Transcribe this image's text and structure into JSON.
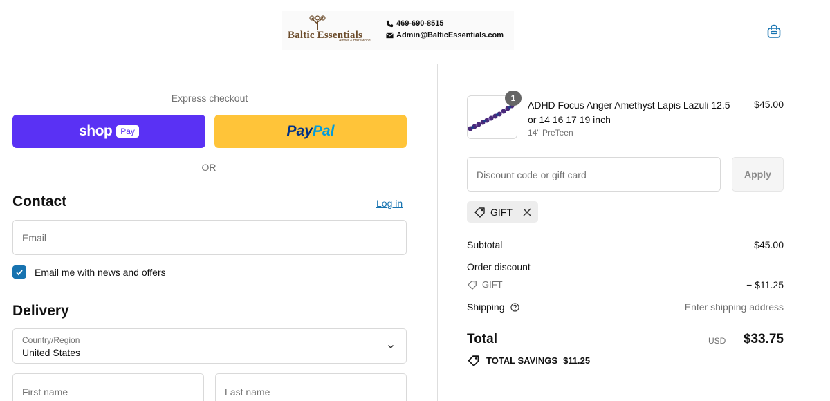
{
  "header": {
    "logo_text": "Baltic Essentials",
    "logo_tagline": "Amber & Hazelwood",
    "phone": "469-690-8515",
    "email": "Admin@BalticEssentials.com",
    "cart_icon": "shopping-bag-icon"
  },
  "express": {
    "label": "Express checkout",
    "shop_word": "shop",
    "shop_pay_pill": "Pay",
    "paypal_part1": "Pay",
    "paypal_part2": "Pal",
    "or_text": "OR"
  },
  "contact": {
    "title": "Contact",
    "login_link": "Log in",
    "email_placeholder": "Email",
    "newsletter_label": "Email me with news and offers",
    "newsletter_checked": true
  },
  "delivery": {
    "title": "Delivery",
    "country_label": "Country/Region",
    "country_value": "United States",
    "first_name_placeholder": "First name",
    "last_name_placeholder": "Last name"
  },
  "order": {
    "item": {
      "quantity": "1",
      "title": "ADHD Focus Anger Amethyst Lapis Lazuli 12.5 or 14 16 17 19 inch",
      "variant": "14\" PreTeen",
      "price": "$45.00"
    },
    "discount_placeholder": "Discount code or gift card",
    "apply_label": "Apply",
    "applied_code": "GIFT",
    "subtotal_label": "Subtotal",
    "subtotal_value": "$45.00",
    "order_discount_label": "Order discount",
    "discount_code": "GIFT",
    "discount_value": "− $11.25",
    "shipping_label": "Shipping",
    "shipping_value": "Enter shipping address",
    "total_label": "Total",
    "total_currency": "USD",
    "total_value": "$33.75",
    "savings_label": "TOTAL SAVINGS",
    "savings_value": "$11.25"
  },
  "colors": {
    "shop_pay": "#5a31f4",
    "paypal": "#ffc439",
    "link": "#1773b0"
  }
}
